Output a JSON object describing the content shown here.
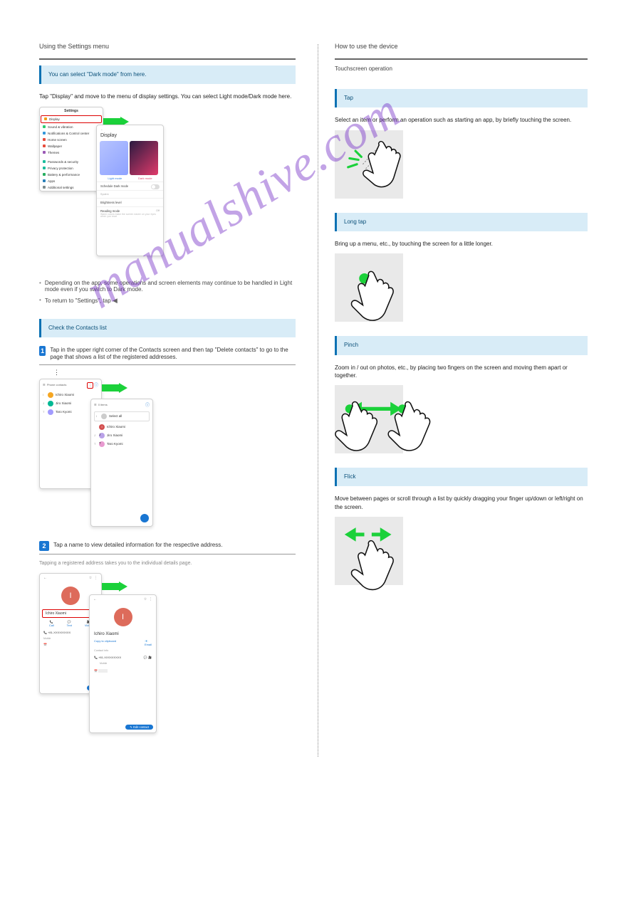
{
  "left": {
    "sectionHeader": "Using the Settings menu",
    "hint1": "You can select \"Dark mode\" from here.",
    "intro1": "Tap \"Display\" and move to the menu of display settings. You can select Light mode/Dark mode here.",
    "settingsTitle": "Settings",
    "settingsItems": [
      {
        "label": "Display",
        "color": "#f39c12",
        "outlined": true
      },
      {
        "label": "Sound & vibration",
        "color": "#2ecc71"
      },
      {
        "label": "Notifications & Control center",
        "color": "#3498db"
      },
      {
        "label": "Home screen",
        "color": "#e74c3c"
      },
      {
        "label": "Wallpaper",
        "color": "#e74c3c"
      },
      {
        "label": "Themes",
        "color": "#9b59b6"
      },
      {
        "label": "Passwords & security",
        "color": "#1abc9c"
      },
      {
        "label": "Privacy protection",
        "color": "#1abc9c"
      },
      {
        "label": "Battery & performance",
        "color": "#27ae60"
      },
      {
        "label": "Apps",
        "color": "#2980b9"
      },
      {
        "label": "Additional settings",
        "color": "#7f8c8d"
      }
    ],
    "displayTitle": "Display",
    "displayLight": "Light mode",
    "displayDark": "Dark mode",
    "displayScheduleRow": "Schedule Dark mode",
    "displayBrightnessRow": "Brightness level",
    "displayReadingRowTitle": "Reading mode",
    "displayReadingRowSub": "",
    "displayReadingRowOff": "Off",
    "note1a": "Depending on the app, some operations and screen elements may continue to be handled in Light mode even if you switch to Dark mode.",
    "note1b": "To return to \"Settings\", tap",
    "hint2": "Check the Contacts list",
    "step1Text": "Tap      in the upper right corner of the Contacts screen and then tap \"Delete contacts\" to go to the page that shows a list of the registered addresses.",
    "contactHeader": "Phone contacts",
    "contacts": [
      {
        "initial": "I",
        "name": "Ichiro Xiaomi",
        "av": "or"
      },
      {
        "initial": "J",
        "name": "Jiro Xiaomi",
        "av": "gr"
      },
      {
        "initial": "T",
        "name": "Taro Kyomi",
        "av": "pu"
      }
    ],
    "deleteItemsTitle": "0 items",
    "deleteSelectAll": "Select all",
    "deleteList": [
      {
        "initial": "I",
        "name": "Ichiro Xiaomi"
      },
      {
        "initial": "J",
        "name": "Jiro Xiaomi"
      },
      {
        "initial": "T",
        "name": "Taro Kyomi"
      }
    ],
    "step2Text": "Tap a name to view detailed information for the respective address.",
    "step2Sub": "Tapping a registered address takes you to the individual details page.",
    "contactCardName": "Ichiro Xiaomi",
    "contactActionCall": "Call",
    "contactActionText": "Text",
    "contactActionVideo": "Video",
    "contactInfoLabel": "Contact info",
    "copyClipboard": "Copy to clipboard",
    "emailLabel": "Email",
    "phoneSample": "+81-XXXXXXXXX",
    "mobileLabel": "Mobile",
    "editContact": "Edit contact"
  },
  "right": {
    "sectionHeader": "How to use the device",
    "touchTitle": "Touchscreen operation",
    "hint1": "Tap",
    "body1": "Select an item or perform an operation such as starting an app, by briefly touching the screen.",
    "hint2": "Long tap",
    "body2": "Bring up a menu, etc., by touching the screen for a little longer.",
    "hint3": "Pinch",
    "body3": "Zoom in / out on photos, etc., by placing two fingers on the screen and moving them apart or together.",
    "hint4": "Flick",
    "body4": "Move between pages or scroll through a list by quickly dragging your finger up/down or left/right on the screen."
  },
  "watermark": "manualshive.com"
}
